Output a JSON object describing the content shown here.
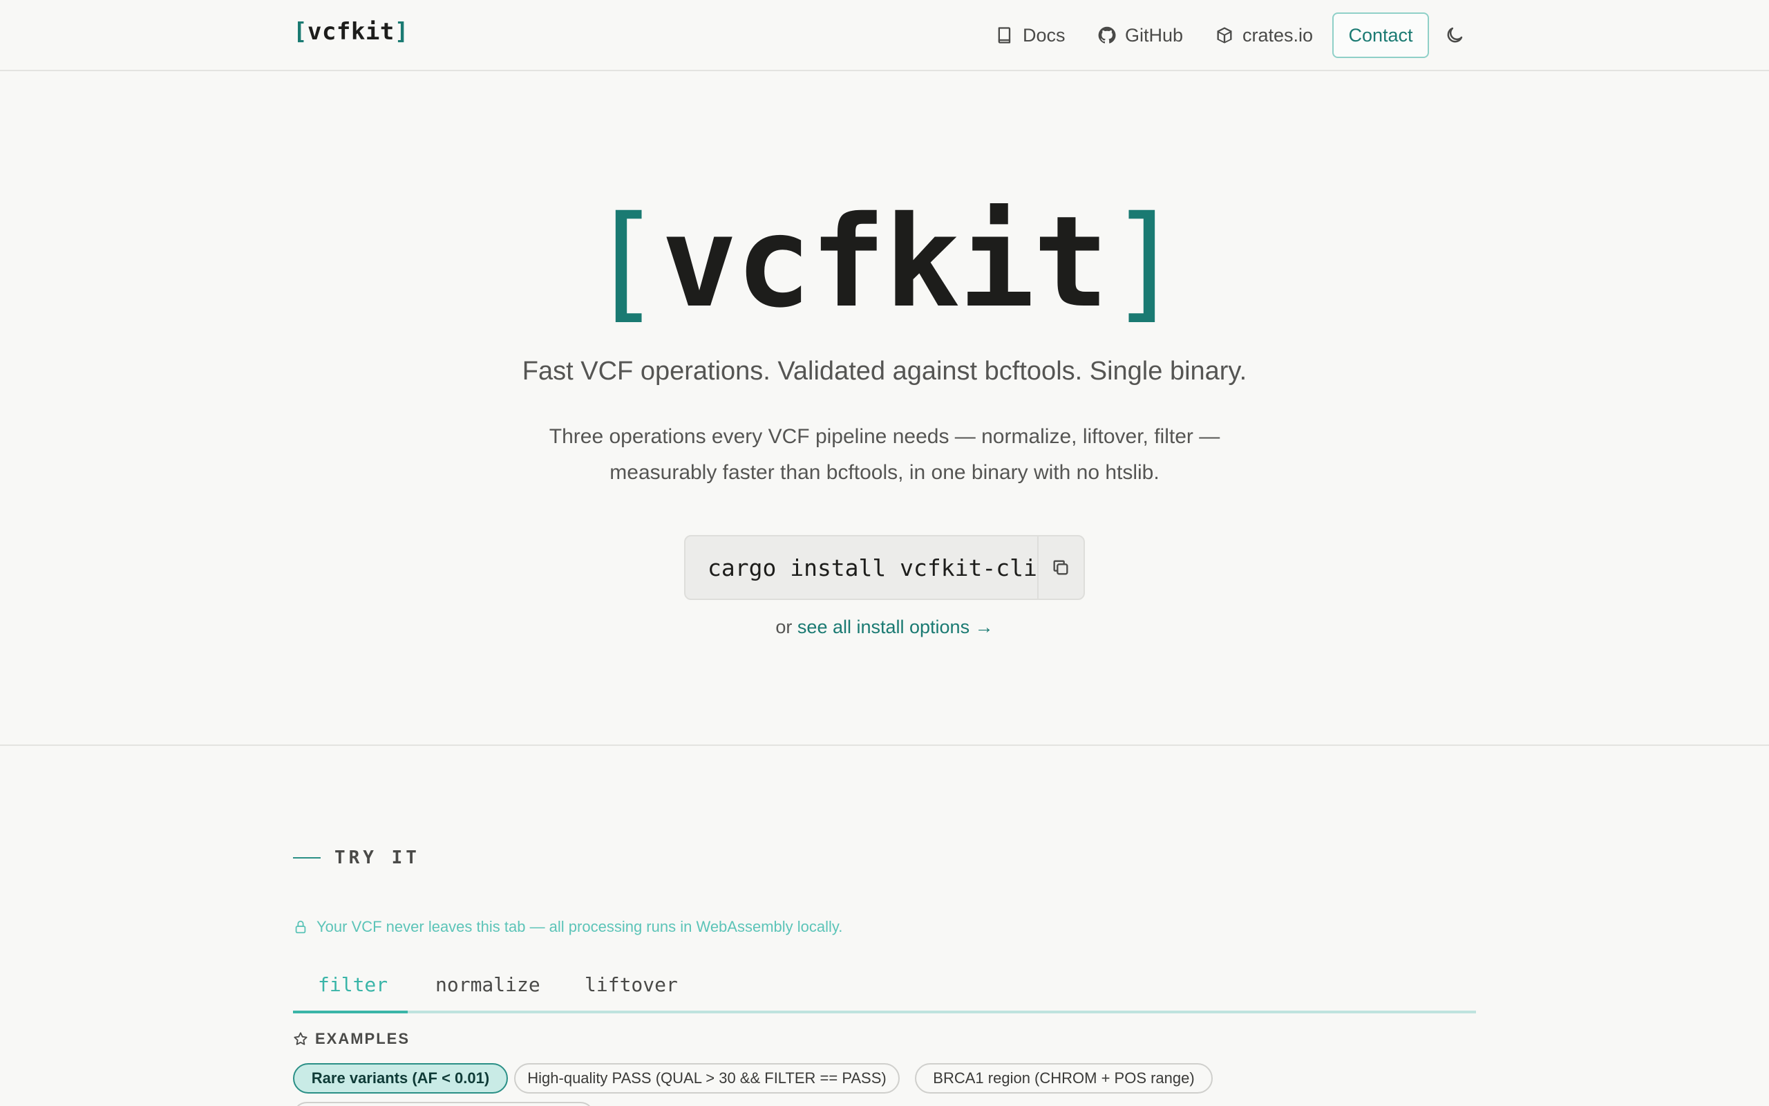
{
  "header": {
    "logo": {
      "open": "[",
      "name": "vcfkit",
      "close": "]"
    },
    "nav": {
      "docs": "Docs",
      "github": "GitHub",
      "crates": "crates.io",
      "contact": "Contact"
    }
  },
  "hero": {
    "logo": {
      "open": "[",
      "name": "vcfkit",
      "close": "]"
    },
    "tagline": "Fast VCF operations. Validated against bcftools. Single binary.",
    "desc_line1": "Three operations every VCF pipeline needs — normalize, liftover, filter —",
    "desc_line2": "measurably faster than bcftools, in one binary with no htslib.",
    "install_cmd": "cargo install vcfkit-cli",
    "install_prefix": "or ",
    "install_link": "see all install options →"
  },
  "try_it": {
    "label": "TRY IT",
    "privacy": "Your VCF never leaves this tab — all processing runs in WebAssembly locally.",
    "tabs": [
      "filter",
      "normalize",
      "liftover"
    ],
    "active_tab": "filter",
    "examples_label": "EXAMPLES",
    "examples": [
      "Rare variants (AF < 0.01)",
      "High-quality PASS (QUAL > 30 && FILTER == PASS)",
      "BRCA1 region (CHROM + POS range)"
    ]
  },
  "colors": {
    "accent": "#1a7a72",
    "accent_light": "#3ab5a8",
    "background": "#f8f8f6"
  }
}
